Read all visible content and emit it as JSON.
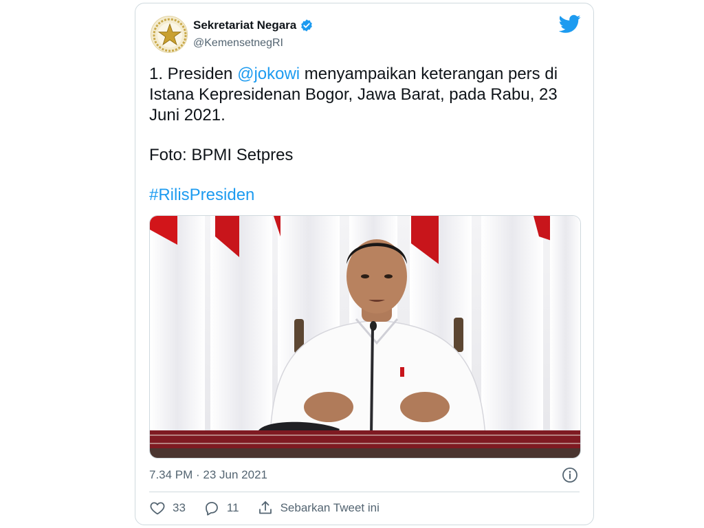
{
  "account": {
    "display_name": "Sekretariat Negara",
    "handle": "@KemensetnegRI",
    "verified": true
  },
  "tweet": {
    "line1_prefix": "1. Presiden ",
    "mention": "@jokowi",
    "line1_suffix": " menyampaikan keterangan pers di Istana Kepresidenan Bogor, Jawa Barat, pada Rabu, 23 Juni 2021.",
    "credit": "Foto: BPMI Setpres",
    "hashtag": "#RilisPresiden"
  },
  "meta": {
    "timestamp": "7.34 PM · 23 Jun 2021"
  },
  "actions": {
    "likes": "33",
    "replies": "11",
    "share_label": "Sebarkan Tweet ini"
  },
  "icons": {
    "brand": "twitter-bird-icon",
    "verified": "verified-badge-icon",
    "info": "info-icon",
    "like": "heart-icon",
    "reply": "reply-icon",
    "share": "share-icon"
  },
  "colors": {
    "accent": "#1d9bf0",
    "text": "#0f1419",
    "muted": "#536471",
    "border": "#cfd9de"
  }
}
